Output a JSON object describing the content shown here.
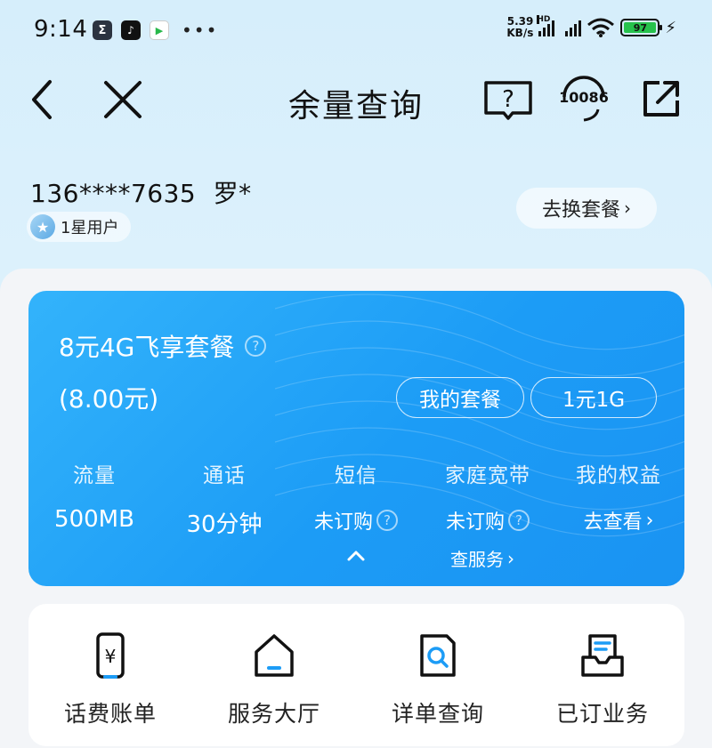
{
  "status_bar": {
    "time": "9:14",
    "net_speed_value": "5.39",
    "net_speed_unit": "KB/s",
    "signal_label": "HD",
    "battery": "97",
    "app_icons": [
      "sigma-app-icon",
      "tiktok-app-icon",
      "kuaishou-app-icon"
    ],
    "more": "•••"
  },
  "nav": {
    "title": "余量查询",
    "service_number": "10086",
    "help_symbol": "?"
  },
  "user": {
    "phone": "136****7635",
    "name": "罗*",
    "level": "1星用户",
    "change_plan": "去换套餐"
  },
  "plan": {
    "name": "8元4G飞享套餐",
    "price": "(8.00元)",
    "my_plan_button": "我的套餐",
    "promo_button": "1元1G",
    "usage": [
      {
        "label": "流量",
        "value": "500MB"
      },
      {
        "label": "通话",
        "value": "30分钟"
      },
      {
        "label": "短信",
        "value": "未订购"
      },
      {
        "label": "家庭宽带",
        "value": "未订购"
      },
      {
        "label": "我的权益",
        "value": "去查看"
      }
    ],
    "service_link": "查服务"
  },
  "quick_actions": [
    {
      "label": "话费账单",
      "icon": "bill-icon"
    },
    {
      "label": "服务大厅",
      "icon": "hall-icon"
    },
    {
      "label": "详单查询",
      "icon": "detail-search-icon"
    },
    {
      "label": "已订业务",
      "icon": "subscribed-icon"
    }
  ],
  "colors": {
    "card_blue": "#1c9cf6",
    "background": "#d6eefb",
    "battery_green": "#27c24c"
  }
}
